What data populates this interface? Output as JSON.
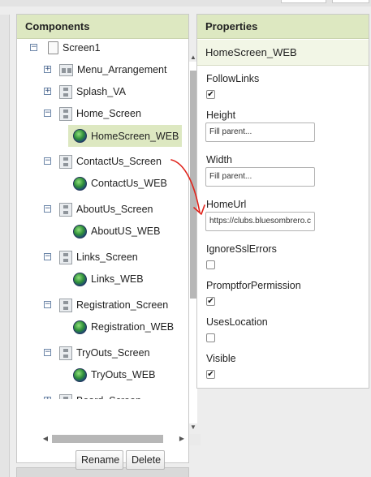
{
  "components": {
    "title": "Components",
    "tree": [
      {
        "label": "Screen1",
        "toggle": "−",
        "icon": "screen-icon"
      },
      {
        "label": "Menu_Arrangement",
        "toggle": "+",
        "icon": "horizontal-arrangement-icon"
      },
      {
        "label": "Splash_VA",
        "toggle": "+",
        "icon": "vertical-arrangement-icon"
      },
      {
        "label": "Home_Screen",
        "toggle": "−",
        "icon": "vertical-arrangement-icon"
      },
      {
        "label": "HomeScreen_WEB",
        "toggle": "",
        "icon": "web-viewer-icon",
        "selected": true
      },
      {
        "label": "ContactUs_Screen",
        "toggle": "−",
        "icon": "vertical-arrangement-icon"
      },
      {
        "label": "ContactUs_WEB",
        "toggle": "",
        "icon": "web-viewer-icon"
      },
      {
        "label": "AboutUs_Screen",
        "toggle": "−",
        "icon": "vertical-arrangement-icon"
      },
      {
        "label": "AboutUS_WEB",
        "toggle": "",
        "icon": "web-viewer-icon"
      },
      {
        "label": "Links_Screen",
        "toggle": "−",
        "icon": "vertical-arrangement-icon"
      },
      {
        "label": "Links_WEB",
        "toggle": "",
        "icon": "web-viewer-icon"
      },
      {
        "label": "Registration_Screen",
        "toggle": "−",
        "icon": "vertical-arrangement-icon"
      },
      {
        "label": "Registration_WEB",
        "toggle": "",
        "icon": "web-viewer-icon"
      },
      {
        "label": "TryOuts_Screen",
        "toggle": "−",
        "icon": "vertical-arrangement-icon"
      },
      {
        "label": "TryOuts_WEB",
        "toggle": "",
        "icon": "web-viewer-icon"
      },
      {
        "label": "Board_Screen",
        "toggle": "+",
        "icon": "vertical-arrangement-icon"
      }
    ],
    "rename_label": "Rename",
    "delete_label": "Delete"
  },
  "properties": {
    "title": "Properties",
    "component_name": "HomeScreen_WEB",
    "follow_links": {
      "label": "FollowLinks",
      "checked": true
    },
    "height": {
      "label": "Height",
      "value": "Fill parent..."
    },
    "width": {
      "label": "Width",
      "value": "Fill parent..."
    },
    "home_url": {
      "label": "HomeUrl",
      "value": "https://clubs.bluesombrero.c"
    },
    "ignore_ssl_errors": {
      "label": "IgnoreSslErrors",
      "checked": false
    },
    "prompt_for_permission": {
      "label": "PromptforPermission",
      "checked": true
    },
    "uses_location": {
      "label": "UsesLocation",
      "checked": false
    },
    "visible": {
      "label": "Visible",
      "checked": true
    }
  },
  "colors": {
    "header_bg": "#dde8c1",
    "selection_bg": "#dde8c1",
    "annotation_arrow": "#e0231b"
  }
}
